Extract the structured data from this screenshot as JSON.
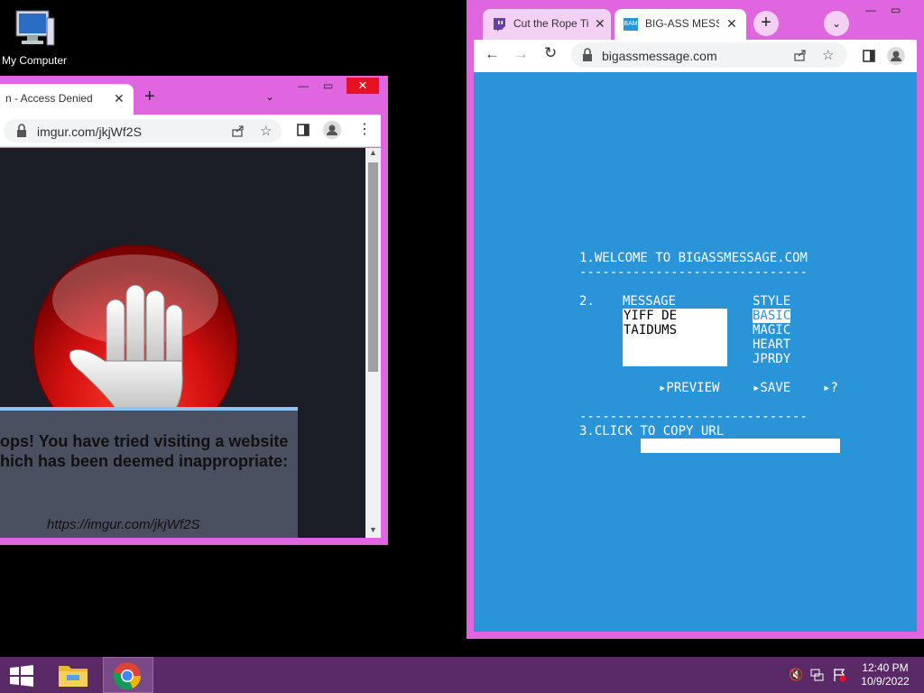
{
  "desktop": {
    "icon_label": "My Computer"
  },
  "left_window": {
    "tab_title": "n - Access Denied",
    "url": "imgur.com/jkjWf2S",
    "message_line1": "ops! You have tried visiting a website",
    "message_line2": "hich has been deemed inappropriate:",
    "blocked_url": "https://imgur.com/jkjWf2S"
  },
  "right_window": {
    "tabs": [
      {
        "title": "Cut the Rope Ti"
      },
      {
        "title": "BIG-ASS MESS"
      }
    ],
    "url": "bigassmessage.com",
    "page": {
      "welcome": "1.WELCOME TO BIGASSMESSAGE.COM",
      "divider": "------------------------------",
      "step2": "2.",
      "message_header": "MESSAGE",
      "message_lines": [
        "YIFF DE",
        "TAIDUMS"
      ],
      "style_header": "STYLE",
      "styles": [
        "BASIC",
        "MAGIC",
        "HEART",
        "JPRDY"
      ],
      "selected_style": "BASIC",
      "preview": "▸PREVIEW",
      "save": "▸SAVE",
      "help": "▸?",
      "divider2": "------------------------------",
      "copy_url": "3.CLICK TO COPY URL"
    }
  },
  "taskbar": {
    "time": "12:40 PM",
    "date": "10/9/2022"
  }
}
